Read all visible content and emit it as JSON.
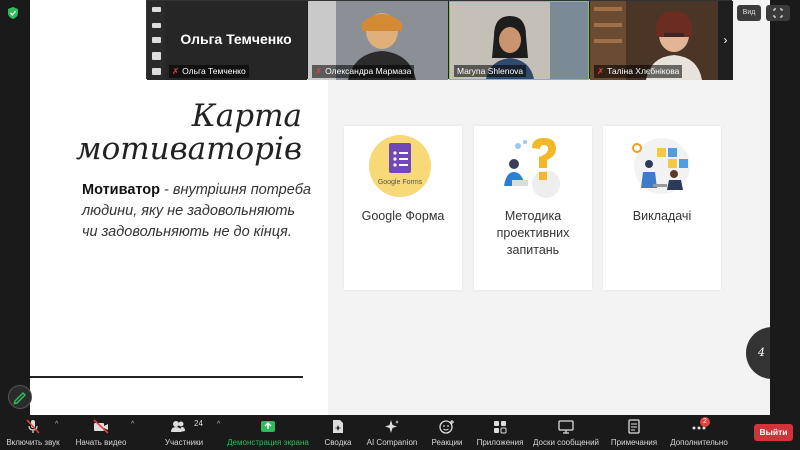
{
  "slide": {
    "title_line1": "Карта",
    "title_line2": "мотиваторів",
    "definition_term": "Мотиватор",
    "definition_text": " - внутрішня потреба людини, яку не задовольняють чи задовольняють не до кінця.",
    "cards": [
      {
        "label": "Google Форма",
        "art_text": "Google Forms"
      },
      {
        "label": "Методика проективних запитань"
      },
      {
        "label": "Викладачі"
      }
    ],
    "page_badge": "4"
  },
  "participants": [
    {
      "name": "Ольга Темченко",
      "big_name": "Ольга Темченко",
      "muted": true
    },
    {
      "name": "Олександра Мармаза",
      "muted": true
    },
    {
      "name": "Maryna Shlenova",
      "muted": false
    },
    {
      "name": "Таліна Хлєбнікова",
      "muted": true
    }
  ],
  "window": {
    "view_label": "Вид"
  },
  "toolbar": {
    "mute": "Включить звук",
    "video": "Начать видео",
    "participants": "Участники",
    "participants_count": "24",
    "share": "Демонстрация экрана",
    "summary": "Сводка",
    "ai": "AI Companion",
    "reactions": "Реакции",
    "apps": "Приложения",
    "whiteboards": "Доски сообщений",
    "notes": "Примечания",
    "more": "Дополнительно",
    "more_badge": "2",
    "leave": "Выйти"
  },
  "colors": {
    "share_green": "#2dbb5b",
    "leave_red": "#d1333a",
    "mute_red": "#e34141"
  }
}
